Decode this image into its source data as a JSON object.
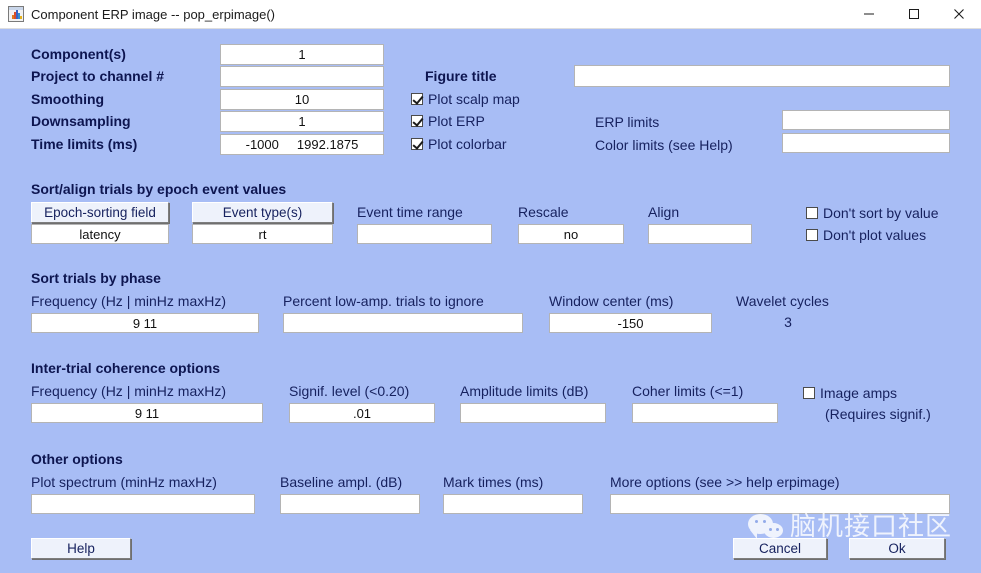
{
  "window": {
    "title": "Component ERP image -- pop_erpimage()",
    "icon": "matlab-icon",
    "minimize": "─",
    "maximize": "□",
    "close": "✕"
  },
  "top_form": {
    "rows": [
      {
        "label": "Component(s)",
        "value": "1"
      },
      {
        "label": "Project to channel #",
        "value": ""
      },
      {
        "label": "Smoothing",
        "value": "10"
      },
      {
        "label": "Downsampling",
        "value": "1"
      },
      {
        "label": "Time limits (ms)",
        "value": "-1000     1992.1875"
      }
    ],
    "figure_title_label": "Figure title",
    "figure_title_value": "",
    "checkboxes": [
      {
        "label": "Plot scalp map",
        "checked": true
      },
      {
        "label": "Plot ERP",
        "checked": true
      },
      {
        "label": "Plot colorbar",
        "checked": true
      }
    ],
    "limits": [
      {
        "label": "ERP limits",
        "value": ""
      },
      {
        "label": "Color limits (see Help)",
        "value": ""
      }
    ]
  },
  "sort_section": {
    "title": "Sort/align trials by epoch event values",
    "epoch_sorting_button": "Epoch-sorting field",
    "epoch_sorting_value": "latency",
    "event_types_button": "Event type(s)",
    "event_types_value": "rt",
    "event_time_range_label": "Event time range",
    "event_time_range_value": "",
    "rescale_label": "Rescale",
    "rescale_value": "no",
    "align_label": "Align",
    "align_value": "",
    "checkboxes": [
      {
        "label": "Don't sort by value",
        "checked": false
      },
      {
        "label": "Don't plot values",
        "checked": false
      }
    ]
  },
  "phase_section": {
    "title": "Sort trials by phase",
    "frequency_label": "Frequency (Hz | minHz maxHz)",
    "frequency_value": "9 11",
    "percent_label": "Percent low-amp. trials to ignore",
    "percent_value": "",
    "window_center_label": "Window center (ms)",
    "window_center_value": "-150",
    "wavelet_label": "Wavelet cycles",
    "wavelet_value": "3"
  },
  "coherence_section": {
    "title": "Inter-trial coherence options",
    "frequency_label": "Frequency (Hz | minHz maxHz)",
    "frequency_value": "9 11",
    "signif_label": "Signif. level (<0.20)",
    "signif_value": ".01",
    "amplitude_label": "Amplitude limits (dB)",
    "amplitude_value": "",
    "coher_label": "Coher limits (<=1)",
    "coher_value": "",
    "image_amps_label": "Image amps",
    "image_amps_checked": false,
    "requires_signif_note": "(Requires signif.)"
  },
  "other_section": {
    "title": "Other options",
    "plot_spectrum_label": "Plot spectrum (minHz maxHz)",
    "plot_spectrum_value": "",
    "baseline_label": "Baseline ampl. (dB)",
    "baseline_value": "",
    "mark_times_label": "Mark times (ms)",
    "mark_times_value": "",
    "more_options_label": "More options (see >> help erpimage)",
    "more_options_value": ""
  },
  "buttons": {
    "help": "Help",
    "cancel": "Cancel",
    "ok": "Ok"
  },
  "watermark": {
    "text": "脑机接口社区",
    "icon": "wechat-icon"
  },
  "colors": {
    "background": "#a8bdf5",
    "label": "#16215e",
    "field_bg": "#ffffff",
    "button_bg": "#eef2fb",
    "titlebar_bg": "#ffffff"
  }
}
